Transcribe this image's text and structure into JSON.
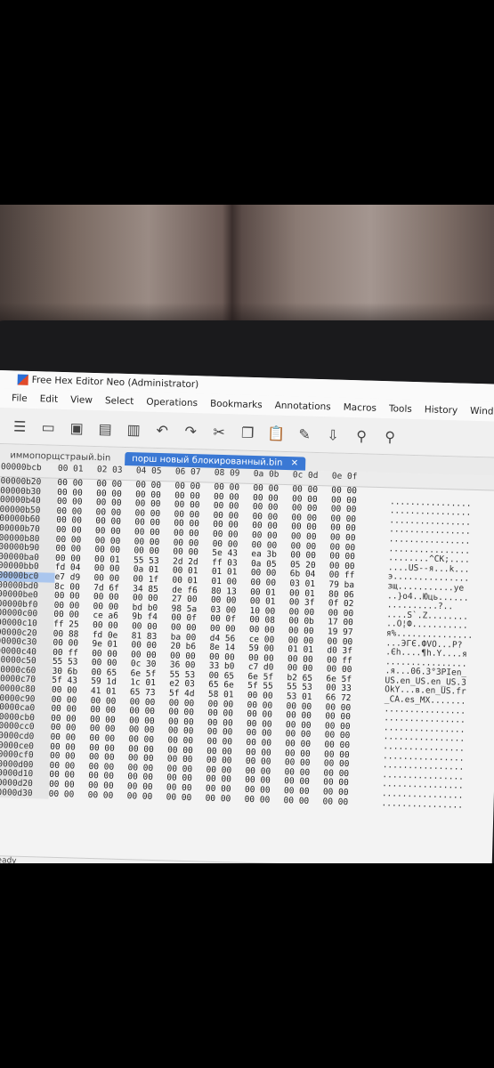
{
  "window": {
    "title": "Free Hex Editor Neo (Administrator)"
  },
  "menu": [
    "File",
    "Edit",
    "View",
    "Select",
    "Operations",
    "Bookmarks",
    "Annotations",
    "Macros",
    "Tools",
    "History",
    "Wind"
  ],
  "toolbar_icons": [
    "notes-icon",
    "open-folder-icon",
    "save-icon",
    "save-all-icon",
    "save-as-icon",
    "undo-icon",
    "redo-icon",
    "cut-icon",
    "copy-icon",
    "paste-icon",
    "eraser-icon",
    "import-icon",
    "find-icon",
    "find-next-icon"
  ],
  "tabs": [
    {
      "label": "иммопорщстраый.bin"
    },
    {
      "label": "порш новый блокированный.bin",
      "close": "✕"
    }
  ],
  "hex": {
    "offset_header": "00000bcb",
    "column_headers": [
      "00 01",
      "02 03",
      "04 05",
      "06 07",
      "08 09",
      "0a 0b",
      "0c 0d",
      "0e 0f"
    ],
    "rows": [
      {
        "o": "00000b20",
        "c": [
          "00 00",
          "00 00",
          "00 00",
          "00 00",
          "00 00",
          "00 00",
          "00 00",
          "00 00"
        ],
        "a": ""
      },
      {
        "o": "00000b30",
        "c": [
          "00 00",
          "00 00",
          "00 00",
          "00 00",
          "00 00",
          "00 00",
          "00 00",
          "00 00"
        ],
        "a": "................"
      },
      {
        "o": "00000b40",
        "c": [
          "00 00",
          "00 00",
          "00 00",
          "00 00",
          "00 00",
          "00 00",
          "00 00",
          "00 00"
        ],
        "a": "................"
      },
      {
        "o": "00000b50",
        "c": [
          "00 00",
          "00 00",
          "00 00",
          "00 00",
          "00 00",
          "00 00",
          "00 00",
          "00 00"
        ],
        "a": "................"
      },
      {
        "o": "00000b60",
        "c": [
          "00 00",
          "00 00",
          "00 00",
          "00 00",
          "00 00",
          "00 00",
          "00 00",
          "00 00"
        ],
        "a": "................"
      },
      {
        "o": "00000b70",
        "c": [
          "00 00",
          "00 00",
          "00 00",
          "00 00",
          "00 00",
          "00 00",
          "00 00",
          "00 00"
        ],
        "a": "................"
      },
      {
        "o": "00000b80",
        "c": [
          "00 00",
          "00 00",
          "00 00",
          "00 00",
          "00 00",
          "00 00",
          "00 00",
          "00 00"
        ],
        "a": "................"
      },
      {
        "o": "00000b90",
        "c": [
          "00 00",
          "00 00",
          "00 00",
          "00 00",
          "5e 43",
          "ea 3b",
          "00 00",
          "00 00"
        ],
        "a": "........^CK;...."
      },
      {
        "o": "00000ba0",
        "c": [
          "00 00",
          "00 01",
          "55 53",
          "2d 2d",
          "ff 03",
          "0a 05",
          "05 20",
          "00 00"
        ],
        "a": "....US--я...k..."
      },
      {
        "o": "00000bb0",
        "c": [
          "fd 04",
          "00 00",
          "0a 01",
          "00 01",
          "01 01",
          "00 00",
          "6b 04",
          "00 ff"
        ],
        "a": "э..............."
      },
      {
        "o": "00000bc0",
        "c": [
          "e7 d9",
          "00 00",
          "00 1f",
          "00 01",
          "01 00",
          "00 00",
          "03 01",
          "79 ba"
        ],
        "a": "зщ...........yе"
      },
      {
        "o": "00000bd0",
        "c": [
          "8c 00",
          "7d 6f",
          "34 85",
          "de f6",
          "80 13",
          "00 01",
          "00 01",
          "80 06"
        ],
        "a": "..}o4..Юць......"
      },
      {
        "o": "00000be0",
        "c": [
          "00 00",
          "00 00",
          "00 00",
          "27 00",
          "00 00",
          "00 01",
          "00 3f",
          "0f 02"
        ],
        "a": "..........?.."
      },
      {
        "o": "00000bf0",
        "c": [
          "00 00",
          "00 00",
          "bd b0",
          "98 5a",
          "03 00",
          "10 00",
          "00 00",
          "00 00"
        ],
        "a": "....S`.Z........"
      },
      {
        "o": "00000c00",
        "c": [
          "00 00",
          "ce a6",
          "9b f4",
          "00 0f",
          "00 0f",
          "00 08",
          "00 0b",
          "17 00"
        ],
        "a": "..О¦Ф..........."
      },
      {
        "o": "00000c10",
        "c": [
          "ff 25",
          "00 00",
          "00 00",
          "00 00",
          "00 00",
          "00 00",
          "00 00",
          "19 97"
        ],
        "a": "я%..............."
      },
      {
        "o": "00000c20",
        "c": [
          "00 88",
          "fd 0e",
          "81 83",
          "ba 00",
          "d4 56",
          "ce 00",
          "00 00",
          "00 00"
        ],
        "a": "...ЭГЄ.ФVO...P?"
      },
      {
        "o": "00000c30",
        "c": [
          "00 00",
          "9e 01",
          "00 00",
          "20 b6",
          "8e 14",
          "59 00",
          "01 01",
          "d0 3f"
        ],
        "a": ".Єh....¶h.Y....я"
      },
      {
        "o": "00000c40",
        "c": [
          "00 ff",
          "00 00",
          "00 00",
          "00 00",
          "00 00",
          "00 00",
          "00 00",
          "00 ff"
        ],
        "a": "................"
      },
      {
        "o": "00000c50",
        "c": [
          "55 53",
          "00 00",
          "0c 30",
          "36 00",
          "33 b0",
          "c7 d0",
          "00 00",
          "00 00"
        ],
        "a": ".я...06.3°ЗPIen_"
      },
      {
        "o": "00000c60",
        "c": [
          "30 6b",
          "00 65",
          "6e 5f",
          "55 53",
          "00 65",
          "6e 5f",
          "b2 65",
          "6e 5f"
        ],
        "a": "US.en_US.en_US.3"
      },
      {
        "o": "00000c70",
        "c": [
          "5f 43",
          "59 1d",
          "1c 01",
          "e2 03",
          "65 6e",
          "5f 55",
          "55 53",
          "00 33"
        ],
        "a": "OkY...в.en_US.fr"
      },
      {
        "o": "00000c80",
        "c": [
          "00 00",
          "41 01",
          "65 73",
          "5f 4d",
          "58 01",
          "00 00",
          "53 01",
          "66 72"
        ],
        "a": "_CA.es_MX......."
      },
      {
        "o": "00000c90",
        "c": [
          "00 00",
          "00 00",
          "00 00",
          "00 00",
          "00 00",
          "00 00",
          "00 00",
          "00 00"
        ],
        "a": "................"
      },
      {
        "o": "00000ca0",
        "c": [
          "00 00",
          "00 00",
          "00 00",
          "00 00",
          "00 00",
          "00 00",
          "00 00",
          "00 00"
        ],
        "a": "................"
      },
      {
        "o": "00000cb0",
        "c": [
          "00 00",
          "00 00",
          "00 00",
          "00 00",
          "00 00",
          "00 00",
          "00 00",
          "00 00"
        ],
        "a": "................"
      },
      {
        "o": "00000cc0",
        "c": [
          "00 00",
          "00 00",
          "00 00",
          "00 00",
          "00 00",
          "00 00",
          "00 00",
          "00 00"
        ],
        "a": "................"
      },
      {
        "o": "00000cd0",
        "c": [
          "00 00",
          "00 00",
          "00 00",
          "00 00",
          "00 00",
          "00 00",
          "00 00",
          "00 00"
        ],
        "a": "................"
      },
      {
        "o": "00000ce0",
        "c": [
          "00 00",
          "00 00",
          "00 00",
          "00 00",
          "00 00",
          "00 00",
          "00 00",
          "00 00"
        ],
        "a": "................"
      },
      {
        "o": "00000cf0",
        "c": [
          "00 00",
          "00 00",
          "00 00",
          "00 00",
          "00 00",
          "00 00",
          "00 00",
          "00 00"
        ],
        "a": "................"
      },
      {
        "o": "00000d00",
        "c": [
          "00 00",
          "00 00",
          "00 00",
          "00 00",
          "00 00",
          "00 00",
          "00 00",
          "00 00"
        ],
        "a": "................"
      },
      {
        "o": "00000d10",
        "c": [
          "00 00",
          "00 00",
          "00 00",
          "00 00",
          "00 00",
          "00 00",
          "00 00",
          "00 00"
        ],
        "a": "................"
      },
      {
        "o": "00000d20",
        "c": [
          "00 00",
          "00 00",
          "00 00",
          "00 00",
          "00 00",
          "00 00",
          "00 00",
          "00 00"
        ],
        "a": "................"
      },
      {
        "o": "00000d30",
        "c": [
          "00 00",
          "00 00",
          "00 00",
          "00 00",
          "00 00",
          "00 00",
          "00 00",
          "00 00"
        ],
        "a": "................"
      }
    ]
  },
  "status": {
    "text": "Ready"
  }
}
